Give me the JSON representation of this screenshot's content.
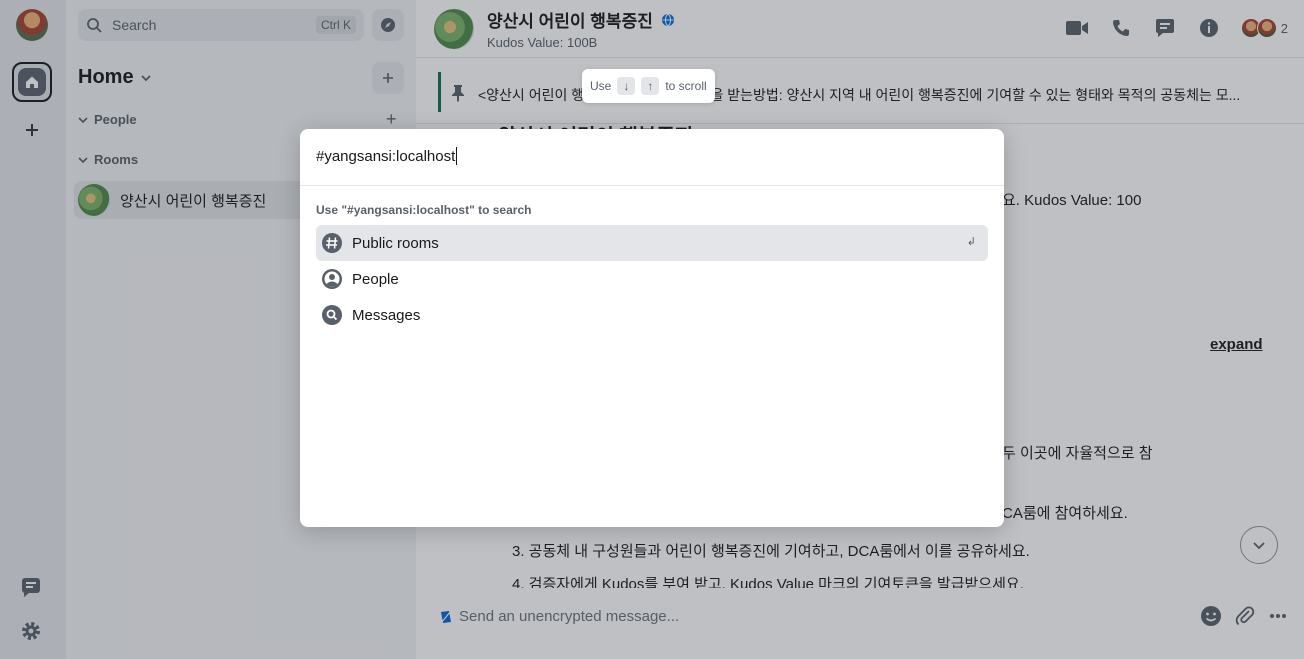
{
  "search": {
    "placeholder": "Search",
    "shortcut": "Ctrl K"
  },
  "room_list": {
    "title": "Home",
    "sections": {
      "people": "People",
      "rooms": "Rooms"
    },
    "rooms": [
      {
        "name": "양산시 어린이 행복증진"
      }
    ]
  },
  "room_header": {
    "title": "양산시 어린이 행복증진",
    "subtitle": "Kudos Value: 100B",
    "member_count": "2"
  },
  "pinned": {
    "text": "<양산시 어린이 행복증진 ... 고 기여토큰을 받는방법: 양산시 지역 내 어린이 행복증진에 기여할 수 있는 형태와 목적의 공동체는 모..."
  },
  "timeline": {
    "heading": "양산시 어린이 행복증진",
    "line1": "요. Kudos Value: 100",
    "expand": "expand",
    "line2": "두 이곳에 자율적으로 참",
    "line3": "CA룸에 참여하세요.",
    "line4": "3. 공동체 내 구성원들과 어린이 행복증진에 기여하고, DCA룸에서 이를 공유하세요.",
    "line5": "4. 검증자에게 Kudos를 부여 받고, Kudos Value 마크의 기여토큰을 발급받으세요."
  },
  "composer": {
    "placeholder": "Send an unencrypted message..."
  },
  "dialog": {
    "query": "#yangsansi:localhost",
    "hint": "Use \"#yangsansi:localhost\" to search",
    "options": [
      {
        "label": "Public rooms",
        "icon": "hash-icon"
      },
      {
        "label": "People",
        "icon": "person-icon"
      },
      {
        "label": "Messages",
        "icon": "search-icon"
      }
    ],
    "enter_glyph": "↲"
  },
  "tooltip": {
    "prefix": "Use",
    "suffix": "to scroll",
    "down": "↓",
    "up": "↑"
  }
}
